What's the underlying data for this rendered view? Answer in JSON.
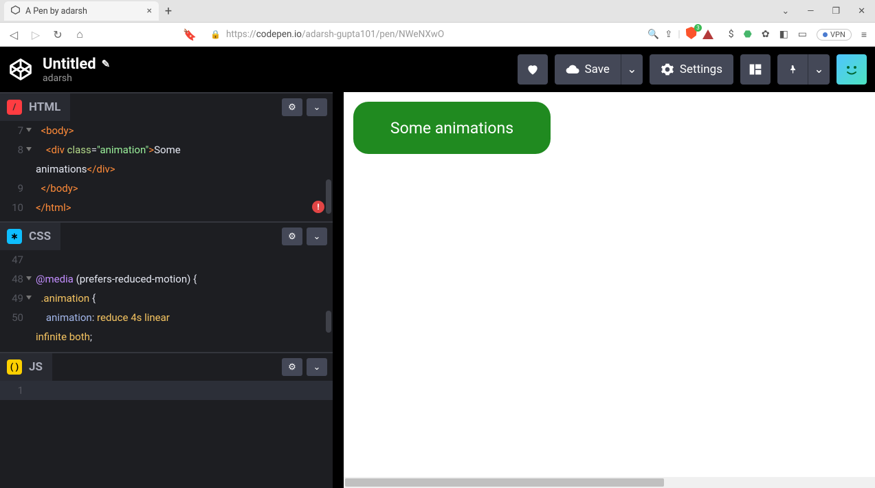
{
  "browser": {
    "tab_title": "A Pen by adarsh",
    "url_scheme": "https://",
    "url_host": "codepen.io",
    "url_path": "/adarsh-gupta101/pen/NWeNXwO",
    "vpn_label": "VPN",
    "shield_count": "3"
  },
  "header": {
    "title": "Untitled",
    "author": "adarsh",
    "save_label": "Save",
    "settings_label": "Settings"
  },
  "editors": {
    "html": {
      "name": "HTML",
      "lines": [
        {
          "n": "7",
          "body_tag": "<body>"
        },
        {
          "n": "8",
          "div_open_a": "<div",
          "div_open_b": " class",
          "div_open_c": "=",
          "div_open_d": "\"animation\"",
          "div_open_e": ">",
          "txt1": "Some"
        },
        {
          "wrap": "animations",
          "div_close": "</div>"
        },
        {
          "n": "9",
          "body_close": "</body>"
        },
        {
          "n": "10",
          "html_close": "</html>"
        }
      ]
    },
    "css": {
      "name": "CSS",
      "lines": [
        {
          "n": "47",
          "blank": " "
        },
        {
          "n": "48",
          "media": "@media",
          "cond": " (prefers-reduced-motion) ",
          "brace": "{"
        },
        {
          "n": "49",
          "sel": ".animation",
          "brace": " {"
        },
        {
          "n": "50",
          "prop": "animation",
          "colon": ": ",
          "vals": "reduce 4s linear"
        },
        {
          "wrap_vals": "infinite both",
          "semi": ";"
        }
      ]
    },
    "js": {
      "name": "JS",
      "lines": [
        {
          "n": "1",
          "blank": " "
        }
      ]
    }
  },
  "preview": {
    "pill_text": "Some animations"
  }
}
